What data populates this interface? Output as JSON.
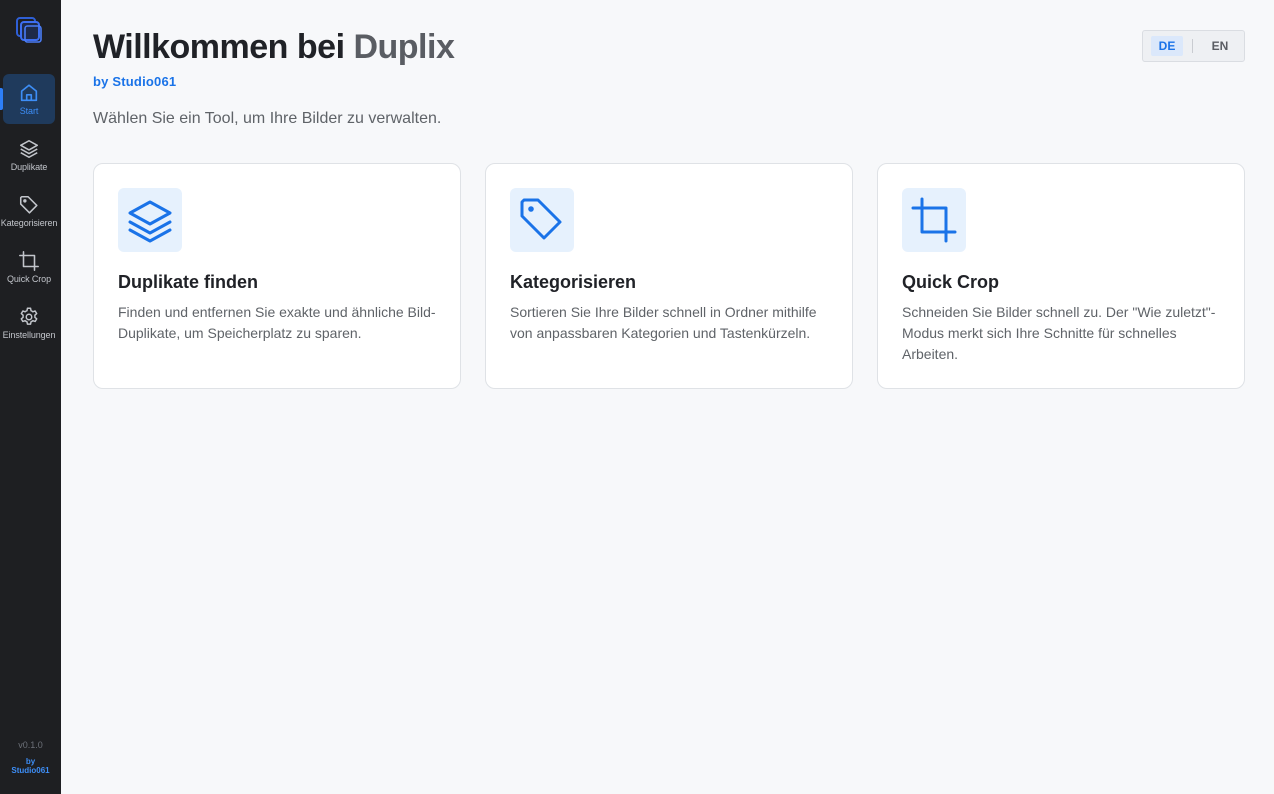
{
  "app": {
    "name": "Duplix",
    "accent": "#1a73e8",
    "sidebar_bg": "#1e1f22"
  },
  "sidebar": {
    "items": [
      {
        "label": "Start",
        "icon": "home-icon",
        "active": true
      },
      {
        "label": "Duplikate",
        "icon": "layers-icon",
        "active": false
      },
      {
        "label": "Kategorisieren",
        "icon": "tag-icon",
        "active": false
      },
      {
        "label": "Quick Crop",
        "icon": "crop-icon",
        "active": false
      },
      {
        "label": "Einstellungen",
        "icon": "gear-icon",
        "active": false
      }
    ],
    "version": "v0.1.0",
    "by_line1": "by",
    "by_line2": "Studio061"
  },
  "header": {
    "title_prefix": "Willkommen bei ",
    "title_brand": "Duplix",
    "byline": "by Studio061",
    "subtitle": "Wählen Sie ein Tool, um Ihre Bilder zu verwalten."
  },
  "language": {
    "options": [
      "DE",
      "EN"
    ],
    "selected": "DE"
  },
  "cards": [
    {
      "title": "Duplikate finden",
      "icon": "layers-icon",
      "description": "Finden und entfernen Sie exakte und ähnliche Bild-Duplikate, um Speicherplatz zu sparen."
    },
    {
      "title": "Kategorisieren",
      "icon": "tag-icon",
      "description": "Sortieren Sie Ihre Bilder schnell in Ordner mithilfe von anpassbaren Kategorien und Tastenkürzeln."
    },
    {
      "title": "Quick Crop",
      "icon": "crop-icon",
      "description": "Schneiden Sie Bilder schnell zu. Der \"Wie zuletzt\"-Modus merkt sich Ihre Schnitte für schnelles Arbeiten."
    }
  ]
}
